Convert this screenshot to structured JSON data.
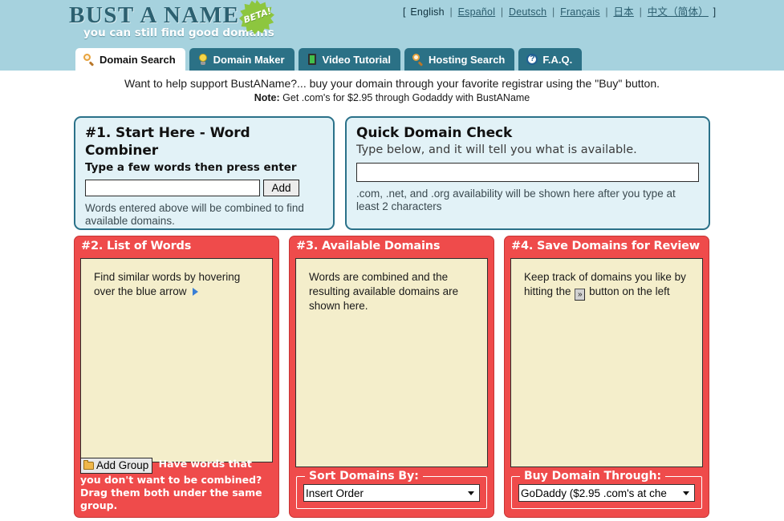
{
  "header": {
    "logo_title": "BUST A NAME",
    "logo_tagline": "you can still find good domains",
    "beta_badge": "BETA!",
    "language_bar": {
      "open_bracket": "[",
      "close_bracket": "]",
      "separator": "|",
      "languages": [
        {
          "label": "English",
          "current": true
        },
        {
          "label": "Español",
          "current": false
        },
        {
          "label": "Deutsch",
          "current": false
        },
        {
          "label": "Français",
          "current": false
        },
        {
          "label": "日本",
          "current": false
        },
        {
          "label": "中文（简体）",
          "current": false
        }
      ]
    },
    "tabs": [
      {
        "label": "Domain Search",
        "icon": "search-icon",
        "active": true
      },
      {
        "label": "Domain Maker",
        "icon": "lightbulb-icon",
        "active": false
      },
      {
        "label": "Video Tutorial",
        "icon": "film-icon",
        "active": false
      },
      {
        "label": "Hosting Search",
        "icon": "search-icon",
        "active": false
      },
      {
        "label": "F.A.Q.",
        "icon": "question-icon",
        "active": false
      }
    ]
  },
  "support_note": {
    "line1": "Want to help support BustAName?... buy your domain through your favorite registrar using the \"Buy\" button.",
    "note_label": "Note:",
    "line2": "Get .com's for $2.95 through Godaddy with BustAName"
  },
  "word_combiner": {
    "heading": "#1. Start Here - Word Combiner",
    "subheading": "Type a few words then press enter",
    "input_value": "",
    "input_placeholder": "",
    "add_label": "Add",
    "help": "Words entered above will be combined to find available domains."
  },
  "quick_check": {
    "heading": "Quick Domain Check",
    "subheading": "Type below, and it will tell you what is available.",
    "input_value": "",
    "input_placeholder": "",
    "help": ".com, .net, and .org availability will be shown here after you type at least 2 characters"
  },
  "word_list": {
    "title": "#2. List of Words",
    "body_before_arrow": "Find similar words by hovering over the blue arrow",
    "add_group_label": "Add Group",
    "footer_text": "Have words that you don't want to be combined?  Drag them both under the same group."
  },
  "available_domains": {
    "title": "#3. Available Domains",
    "body": "Words are combined and the resulting available domains are shown here.",
    "sort_legend": "Sort Domains By:",
    "sort_selected": "Insert Order",
    "sort_options": [
      "Insert Order"
    ]
  },
  "saved_domains": {
    "title": "#4. Save Domains for Review",
    "body_before_button": "Keep track of domains you like by hitting the",
    "save_button_glyph": "»",
    "body_after_button": "button on the left",
    "buy_legend": "Buy Domain Through:",
    "buy_selected": "GoDaddy ($2.95 .com's at che",
    "buy_options": [
      "GoDaddy ($2.95 .com's at che"
    ]
  },
  "colors": {
    "header_band": "#a6d2de",
    "tab_active_bg": "#ffffff",
    "tab_inactive_bg": "#2b7186",
    "panel_blue_bg": "#e2f2f7",
    "panel_blue_border": "#2a7189",
    "panel_red_bg": "#ef4b4b",
    "cream_bg": "#f4eecb",
    "logo_teal": "#2c6070",
    "beta_green": "#8dc63f"
  }
}
